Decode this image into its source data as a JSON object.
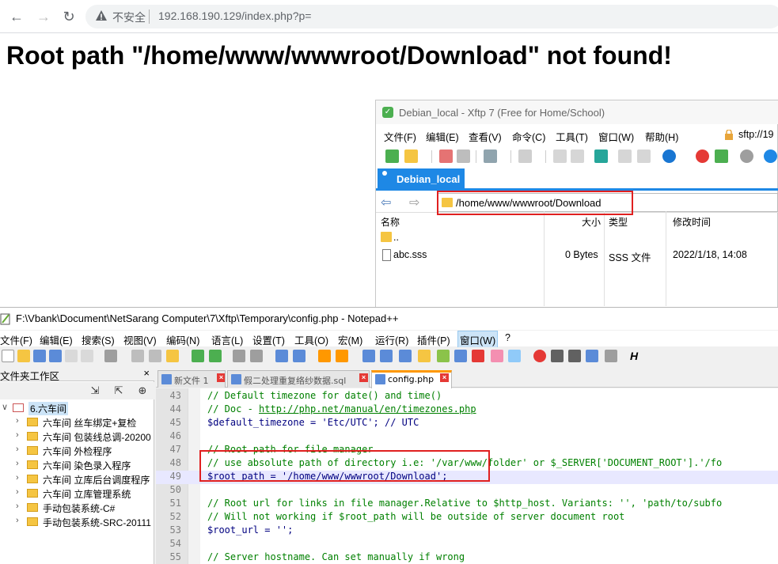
{
  "browser": {
    "back": "←",
    "forward": "→",
    "reload": "↻",
    "not_secure": "不安全",
    "url": "192.168.190.129/index.php?p="
  },
  "page": {
    "heading": "Root path \"/home/www/wwwroot/Download\" not found!"
  },
  "xftp": {
    "title": "Debian_local - Xftp 7 (Free for Home/School)",
    "menu": [
      "文件(F)",
      "编辑(E)",
      "查看(V)",
      "命令(C)",
      "工具(T)",
      "窗口(W)",
      "帮助(H)"
    ],
    "sftp": "sftp://19",
    "tab": "Debian_local",
    "path": "/home/www/wwwroot/Download",
    "columns": {
      "name": "名称",
      "size": "大小",
      "type": "类型",
      "mtime": "修改时间"
    },
    "rows": [
      {
        "name": "..",
        "size": "",
        "type": "",
        "mtime": ""
      },
      {
        "name": "abc.sss",
        "size": "0 Bytes",
        "type": "SSS 文件",
        "mtime": "2022/1/18, 14:08"
      }
    ]
  },
  "npp": {
    "title": "F:\\Vbank\\Document\\NetSarang Computer\\7\\Xftp\\Temporary\\config.php - Notepad++",
    "menu": [
      "文件(F)",
      "编辑(E)",
      "搜索(S)",
      "视图(V)",
      "编码(N)",
      "语言(L)",
      "设置(T)",
      "工具(O)",
      "宏(M)",
      "运行(R)",
      "插件(P)",
      "窗口(W)",
      "?"
    ],
    "workspace_title": "文件夹工作区",
    "workspace_close": "×",
    "tree": [
      {
        "label": "6.六车间",
        "exp": "∨"
      },
      {
        "label": "六车间 丝车绑定+复检",
        "exp": "›"
      },
      {
        "label": "六车间 包装线总调-20200",
        "exp": "›"
      },
      {
        "label": "六车间 外检程序",
        "exp": "›"
      },
      {
        "label": "六车间 染色录入程序",
        "exp": "›"
      },
      {
        "label": "六车间 立库后台调度程序",
        "exp": "›"
      },
      {
        "label": "六车间 立库管理系统",
        "exp": "›"
      },
      {
        "label": "手动包装系统-C#",
        "exp": "›"
      },
      {
        "label": "手动包装系统-SRC-20111",
        "exp": "›"
      }
    ],
    "tabs": [
      {
        "label": "新文件 1",
        "close": "×"
      },
      {
        "label": "假二处理重复络纱数据.sql",
        "close": "×"
      },
      {
        "label": "config.php",
        "close": "×"
      }
    ],
    "lines": [
      {
        "n": "43",
        "text": "// Default timezone for date() and time()"
      },
      {
        "n": "44",
        "text_pre": "// Doc - ",
        "link": "http://php.net/manual/en/timezones.php"
      },
      {
        "n": "45",
        "text": "$default_timezone = 'Etc/UTC'; // UTC"
      },
      {
        "n": "46",
        "text": ""
      },
      {
        "n": "47",
        "text": "// Root path for file manager"
      },
      {
        "n": "48",
        "text": "// use absolute path of directory i.e: '/var/www/folder' or $_SERVER['DOCUMENT_ROOT'].'/fo"
      },
      {
        "n": "49",
        "text": "$root_path = '/home/www/wwwroot/Download';"
      },
      {
        "n": "50",
        "text": ""
      },
      {
        "n": "51",
        "text": "// Root url for links in file manager.Relative to $http_host. Variants: '', 'path/to/subfo"
      },
      {
        "n": "52",
        "text": "// Will not working if $root_path will be outside of server document root"
      },
      {
        "n": "53",
        "text": "$root_url = '';"
      },
      {
        "n": "54",
        "text": ""
      },
      {
        "n": "55",
        "text": "// Server hostname. Can set manually if wrong"
      }
    ]
  },
  "colors": {
    "accent": "#1e88e5",
    "highlight": "#e02020"
  }
}
